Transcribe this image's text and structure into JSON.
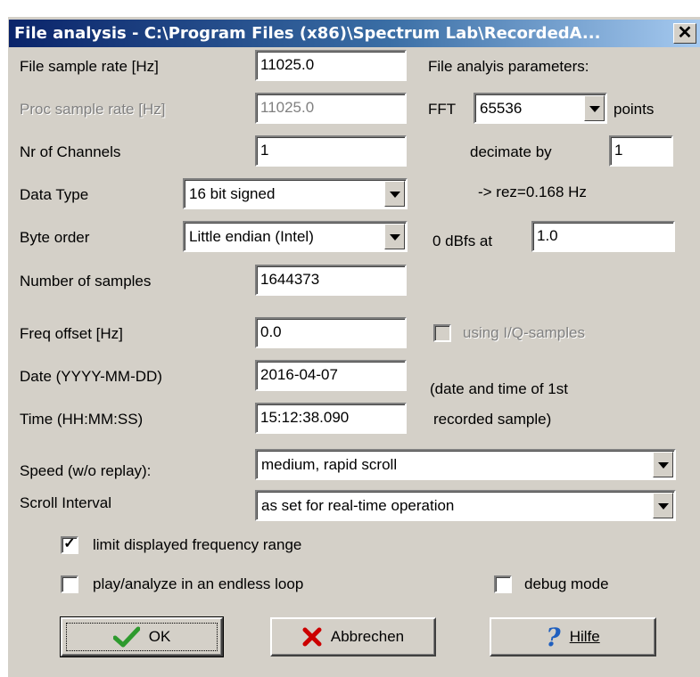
{
  "window": {
    "title": "File analysis - C:\\Program Files (x86)\\Spectrum Lab\\RecordedA..."
  },
  "labels": {
    "file_sample_rate": "File sample rate [Hz]",
    "proc_sample_rate": "Proc sample rate [Hz]",
    "nr_channels": "Nr of Channels",
    "data_type": "Data Type",
    "byte_order": "Byte order",
    "num_samples": "Number of samples",
    "freq_offset": "Freq offset [Hz]",
    "date": "Date (YYYY-MM-DD)",
    "time": "Time (HH:MM:SS)",
    "speed": "Speed (w/o replay):",
    "scroll_interval": "Scroll Interval",
    "params_title": "File analyis parameters:",
    "fft": "FFT",
    "points": "points",
    "decimate_by": "decimate by",
    "rez": "-> rez=0.168 Hz",
    "dbfs_at": "0 dBfs at",
    "iq_samples": "using I/Q-samples",
    "note_line1": "(date and time of 1st",
    "note_line2": "recorded sample)"
  },
  "values": {
    "file_sample_rate": "11025.0",
    "proc_sample_rate": "11025.0",
    "nr_channels": "1",
    "data_type": "16 bit signed",
    "byte_order": "Little endian (Intel)",
    "num_samples": "1644373",
    "freq_offset": "0.0",
    "date": "2016-04-07",
    "time": "15:12:38.090",
    "fft": "65536",
    "decimate": "1",
    "dbfs": "1.0",
    "speed": "medium, rapid scroll",
    "scroll_interval": "as set for real-time operation"
  },
  "checkboxes": {
    "limit_freq": {
      "label": "limit displayed frequency range",
      "checked": true
    },
    "endless_loop": {
      "label": "play/analyze in an endless loop",
      "checked": false
    },
    "debug": {
      "label": "debug mode",
      "checked": false
    },
    "iq": {
      "checked": false
    }
  },
  "buttons": {
    "ok": "OK",
    "cancel": "Abbrechen",
    "help": "Hilfe"
  },
  "colors": {
    "face": "#d4d0c8",
    "title_start": "#0a246a",
    "title_end": "#a6caf0",
    "ok_check": "#2e9a2e",
    "cancel_x": "#cc0000",
    "help_q": "#1f5fbf"
  }
}
